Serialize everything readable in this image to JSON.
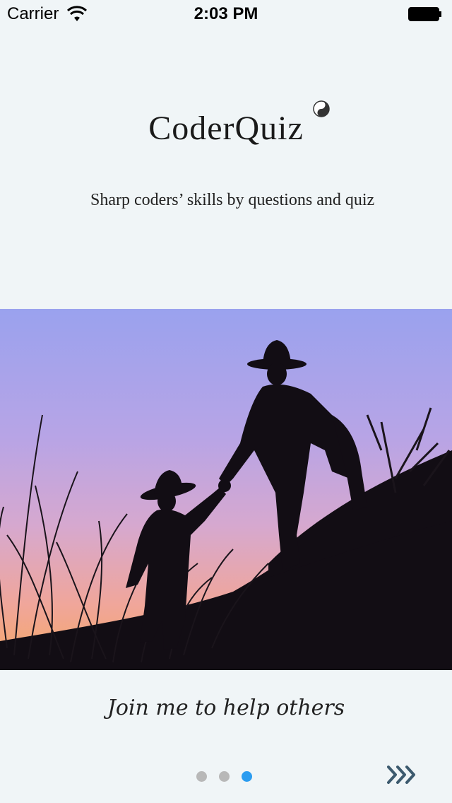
{
  "status_bar": {
    "carrier": "Carrier",
    "time": "2:03 PM"
  },
  "app": {
    "title": "CoderQuiz",
    "tagline": "Sharp coders’ skills by questions and  quiz"
  },
  "slide": {
    "caption": "Join me to help others",
    "image_icon": "silhouette-photo"
  },
  "pager": {
    "total": 3,
    "current": 3
  },
  "colors": {
    "background": "#f0f5f7",
    "active_dot": "#2b9cf0",
    "inactive_dot": "#b8b8b8",
    "next_arrow": "#3c5a6e"
  }
}
